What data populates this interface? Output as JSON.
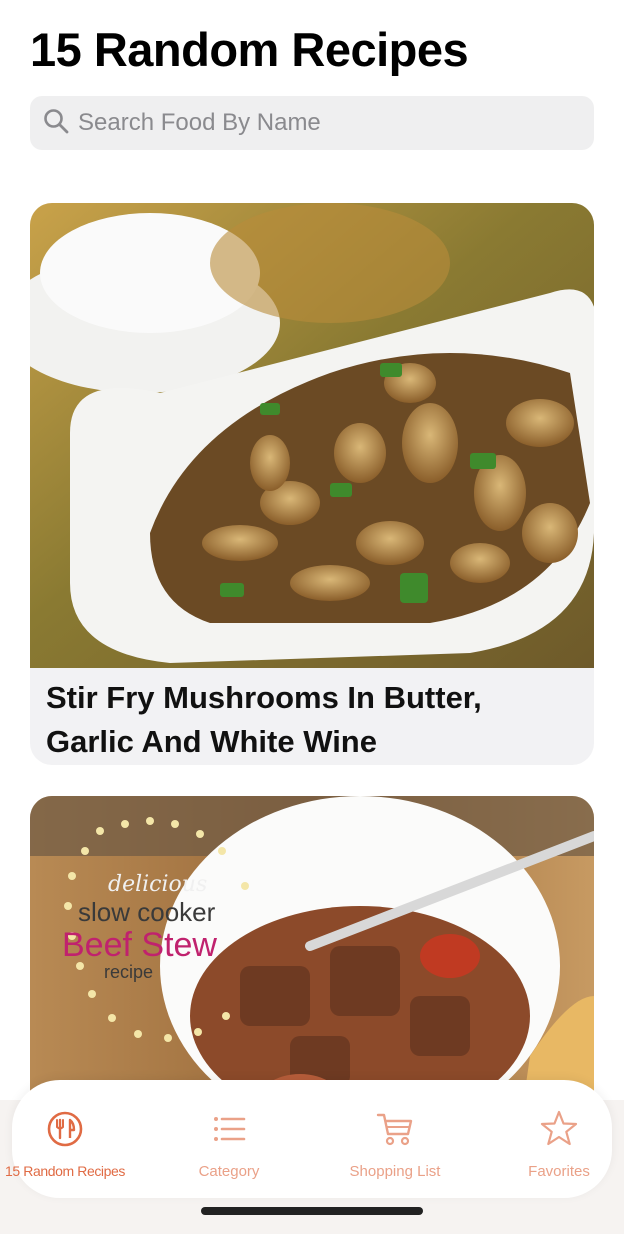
{
  "header": {
    "title": "15 Random Recipes"
  },
  "search": {
    "placeholder": "Search Food By Name",
    "value": ""
  },
  "recipes": [
    {
      "title": "Stir Fry Mushrooms In Butter, Garlic And White Wine"
    },
    {
      "title": "",
      "image_text": [
        "delicious",
        "slow cooker",
        "Beef Stew",
        "recipe"
      ]
    }
  ],
  "tabs": [
    {
      "label": "15 Random Recipes",
      "icon": "fork-knife-icon",
      "active": true
    },
    {
      "label": "Category",
      "icon": "list-icon",
      "active": false
    },
    {
      "label": "Shopping List",
      "icon": "cart-icon",
      "active": false
    },
    {
      "label": "Favorites",
      "icon": "star-icon",
      "active": false
    }
  ],
  "colors": {
    "accent": "#e06b44",
    "accent_light": "#eaa188",
    "search_bg": "#efeff0",
    "card_bg": "#f2f2f4"
  }
}
